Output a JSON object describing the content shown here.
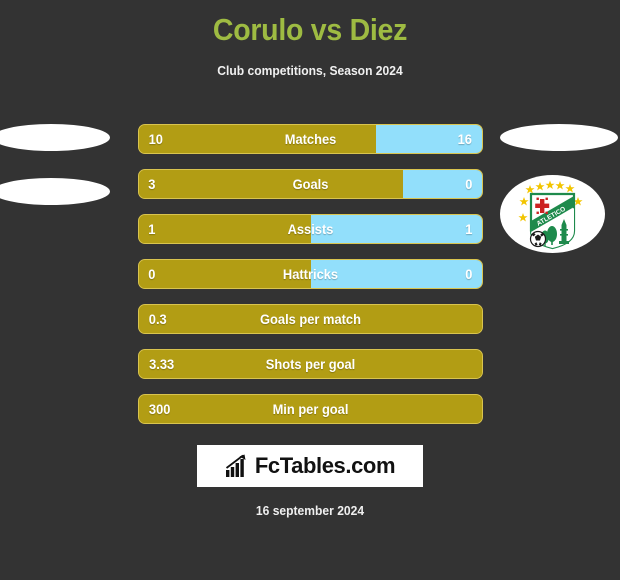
{
  "header": {
    "title": "Corulo vs Diez",
    "subtitle": "Club competitions, Season 2024",
    "title_color": "#9ebb42"
  },
  "footer": {
    "date": "16 september 2024",
    "brand": "FcTables.com",
    "brand_icon": "bar-chart-growth-icon"
  },
  "colors": {
    "background": "#333333",
    "home_bar": "#b29d14",
    "away_bar": "#92dffb",
    "bar_border": "#d9c44f",
    "text": "#ffffff"
  },
  "crest": {
    "name": "club-crest",
    "shield_green": "#1e8a4c",
    "star_color": "#f2c500",
    "cross_color": "#cc2222"
  },
  "chart_data": {
    "type": "bar",
    "title": "Corulo vs Diez",
    "subtitle": "Club competitions, Season 2024",
    "orientation": "horizontal-diverging",
    "series": [
      {
        "name": "Corulo",
        "color": "#b29d14",
        "side": "left"
      },
      {
        "name": "Diez",
        "color": "#92dffb",
        "side": "right"
      }
    ],
    "categories": [
      "Matches",
      "Goals",
      "Assists",
      "Hattricks",
      "Goals per match",
      "Shots per goal",
      "Min per goal"
    ],
    "rows": [
      {
        "label": "Matches",
        "left": "10",
        "right": "16",
        "left_pct": 69,
        "has_right": true
      },
      {
        "label": "Goals",
        "left": "3",
        "right": "0",
        "left_pct": 77,
        "has_right": true
      },
      {
        "label": "Assists",
        "left": "1",
        "right": "1",
        "left_pct": 50,
        "has_right": true
      },
      {
        "label": "Hattricks",
        "left": "0",
        "right": "0",
        "left_pct": 50,
        "has_right": true
      },
      {
        "label": "Goals per match",
        "left": "0.3",
        "right": "",
        "left_pct": 100,
        "has_right": false
      },
      {
        "label": "Shots per goal",
        "left": "3.33",
        "right": "",
        "left_pct": 100,
        "has_right": false
      },
      {
        "label": "Min per goal",
        "left": "300",
        "right": "",
        "left_pct": 100,
        "has_right": false
      }
    ],
    "legend": [
      "Corulo",
      "Diez"
    ],
    "grid": false
  }
}
